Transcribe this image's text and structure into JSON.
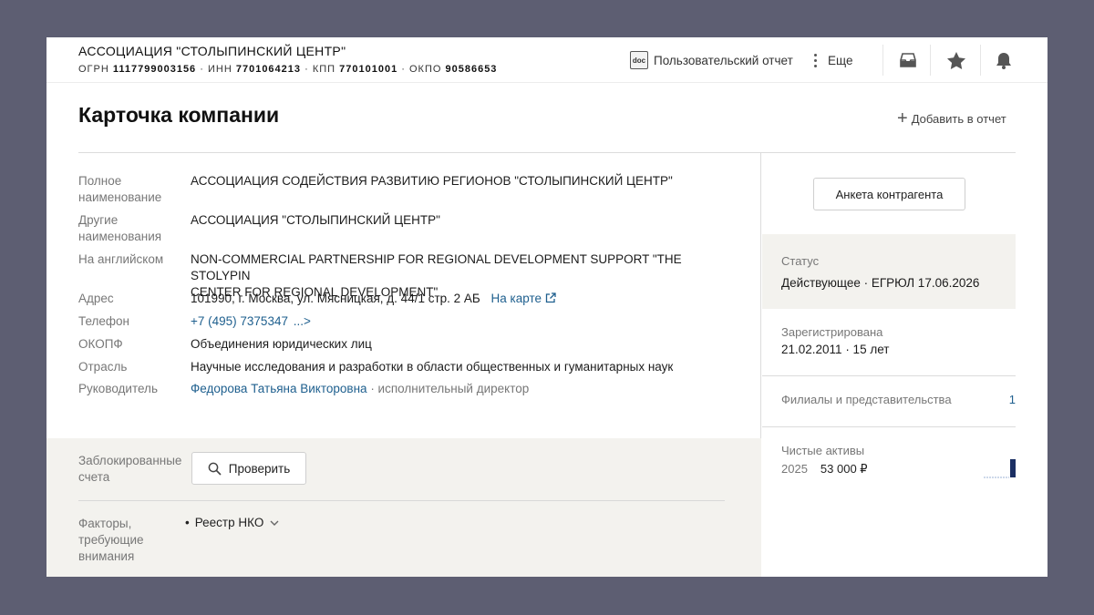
{
  "header": {
    "company_name": "АССОЦИАЦИЯ \"СТОЛЫПИНСКИЙ ЦЕНТР\"",
    "codes": [
      {
        "label": "ОГРН",
        "value": "1117799003156"
      },
      {
        "label": "ИНН",
        "value": "7701064213"
      },
      {
        "label": "КПП",
        "value": "770101001"
      },
      {
        "label": "ОКПО",
        "value": "90586653"
      }
    ],
    "separator": "·",
    "custom_report": {
      "icon": "doc-icon",
      "icon_text": "doc",
      "label": "Пользовательский отчет"
    },
    "more": {
      "icon": "vertical-dots-icon",
      "label": "Еще"
    },
    "icons": [
      "inbox-icon",
      "star-icon",
      "bell-icon"
    ]
  },
  "page": {
    "title": "Карточка компании",
    "add_to_report": "Добавить в отчет"
  },
  "details": {
    "full_name": {
      "label_line1": "Полное",
      "label_line2": "наименование",
      "value": "АССОЦИАЦИЯ СОДЕЙСТВИЯ РАЗВИТИЮ РЕГИОНОВ \"СТОЛЫПИНСКИЙ ЦЕНТР\""
    },
    "other_names": {
      "label_line1": "Другие",
      "label_line2": "наименования",
      "value": "АССОЦИАЦИЯ \"СТОЛЫПИНСКИЙ ЦЕНТР\""
    },
    "english": {
      "label": "На английском",
      "value_line1": "NON-COMMERCIAL PARTNERSHIP FOR REGIONAL DEVELOPMENT SUPPORT \"THE STOLYPIN",
      "value_line2": "CENTER FOR REGIONAL DEVELOPMENT\""
    },
    "address": {
      "label": "Адрес",
      "value": "101990, г. Москва, ул. Мясницкая, д. 44/1 стр. 2 АБ",
      "map_link": "На карте"
    },
    "phone": {
      "label": "Телефон",
      "value": "+7 (495) 7375347",
      "more": "...>"
    },
    "okopf": {
      "label": "ОКОПФ",
      "value": "Объединения юридических лиц"
    },
    "industry": {
      "label": "Отрасль",
      "value": "Научные исследования и разработки в области общественных и гуманитарных наук"
    },
    "director": {
      "label": "Руководитель",
      "name": "Федорова Татьяна Викторовна",
      "role": "· исполнительный директор"
    }
  },
  "blocked_accounts": {
    "label_line1": "Заблокированные",
    "label_line2": "счета",
    "button": "Проверить"
  },
  "factors": {
    "label_line1": "Факторы,",
    "label_line2": "требующие",
    "label_line3": "внимания",
    "item": "Реестр НКО"
  },
  "sidebar": {
    "anketa_button": "Анкета контрагента",
    "status_label": "Статус",
    "status_value": "Действующее · ЕГРЮЛ 17.06.2026",
    "registered_label": "Зарегистрирована",
    "registered_value": "21.02.2011 · 15 лет",
    "branches_label": "Филиалы и представительства",
    "branches_count": "1",
    "net_assets_label": "Чистые активы",
    "net_assets_year": "2025",
    "net_assets_value": "53 000 ₽"
  },
  "colors": {
    "link": "#1e5f8e",
    "chart_bar": "#1b2f63",
    "backdrop": "#5d5e72",
    "panel_gray": "#f3f2ee"
  }
}
